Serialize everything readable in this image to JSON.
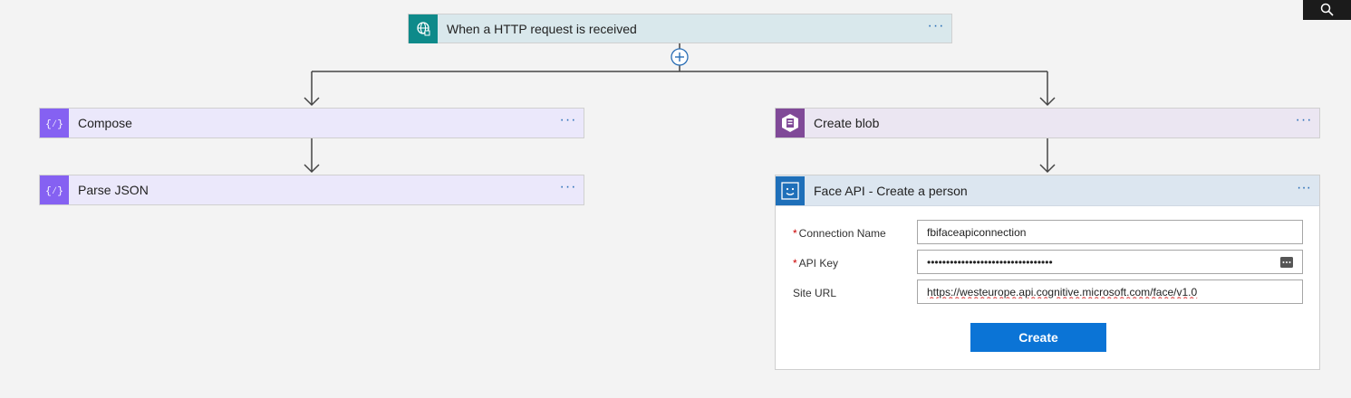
{
  "flow": {
    "trigger": {
      "title": "When a HTTP request is received",
      "more": "···"
    },
    "compose": {
      "title": "Compose",
      "more": "···"
    },
    "parse_json": {
      "title": "Parse JSON",
      "more": "···"
    },
    "create_blob": {
      "title": "Create blob",
      "more": "···"
    },
    "face_api": {
      "title": "Face API - Create a person",
      "more": "···",
      "fields": {
        "connection_name": {
          "label": "Connection Name",
          "required": "*",
          "value": "fbifaceapiconnection"
        },
        "api_key": {
          "label": "API Key",
          "required": "*",
          "value": "•••••••••••••••••••••••••••••••••"
        },
        "site_url": {
          "label": "Site URL",
          "value": "https://westeurope.api.cognitive.microsoft.com/face/v1.0"
        }
      },
      "create_label": "Create"
    }
  },
  "icons": {
    "trigger": "http-request-icon",
    "compose": "braces-icon",
    "parse_json": "braces-icon",
    "create_blob": "blob-storage-icon",
    "face_api": "face-icon",
    "add_step": "plus-circle-icon",
    "search": "search-icon",
    "reveal": "reveal-password-icon"
  },
  "colors": {
    "trigger_accent": "#0e8a8a",
    "data_operations_accent": "#8561f2",
    "blob_accent": "#804998",
    "face_accent": "#1e6fb9",
    "create_button": "#0b74d6",
    "more_dots": "#2b6fb6"
  }
}
